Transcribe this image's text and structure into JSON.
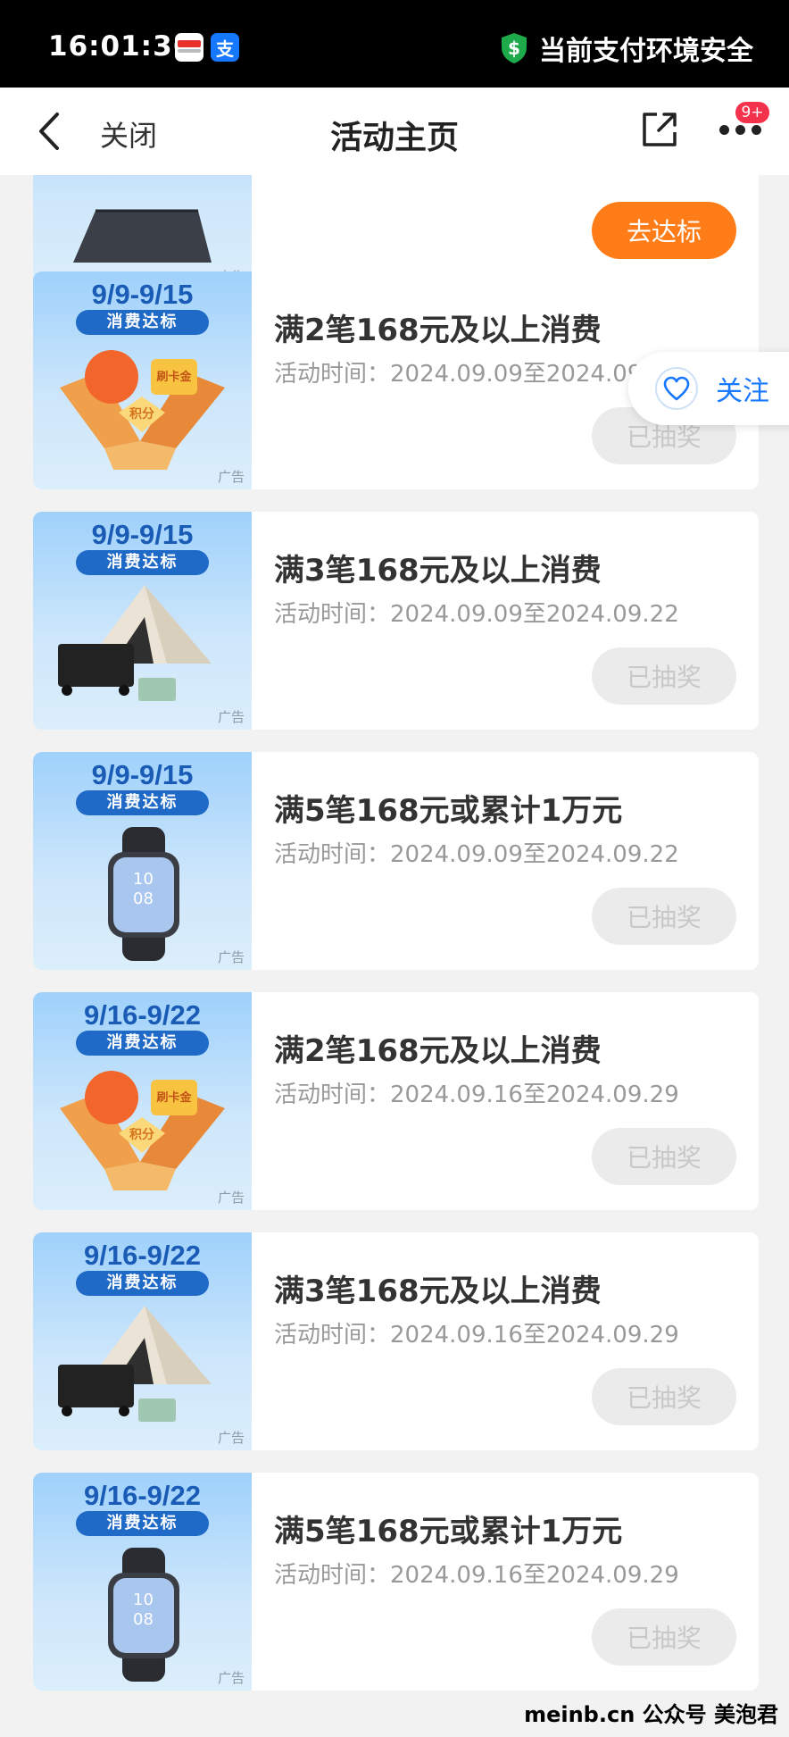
{
  "status_bar": {
    "time": "16:01:36",
    "app_icons": [
      "red-payment-app-icon",
      "alipay-icon"
    ],
    "security_text": "当前支付环境安全"
  },
  "nav": {
    "close_label": "关闭",
    "title": "活动主页",
    "badge": "9+"
  },
  "top_card": {
    "button": "去达标",
    "ad_label": "广告"
  },
  "cards": [
    {
      "date": "9/9-9/15",
      "tag": "消费达标",
      "image": "gift-box",
      "title": "满2笔168元及以上消费",
      "time": "活动时间：2024.09.09至2024.09.22",
      "button": "已抽奖",
      "ad_label": "广告"
    },
    {
      "date": "9/9-9/15",
      "tag": "消费达标",
      "image": "tent",
      "title": "满3笔168元及以上消费",
      "time": "活动时间：2024.09.09至2024.09.22",
      "button": "已抽奖",
      "ad_label": "广告"
    },
    {
      "date": "9/9-9/15",
      "tag": "消费达标",
      "image": "watch",
      "title": "满5笔168元或累计1万元",
      "time": "活动时间：2024.09.09至2024.09.22",
      "button": "已抽奖",
      "ad_label": "广告"
    },
    {
      "date": "9/16-9/22",
      "tag": "消费达标",
      "image": "gift-box",
      "title": "满2笔168元及以上消费",
      "time": "活动时间：2024.09.16至2024.09.29",
      "button": "已抽奖",
      "ad_label": "广告"
    },
    {
      "date": "9/16-9/22",
      "tag": "消费达标",
      "image": "tent",
      "title": "满3笔168元及以上消费",
      "time": "活动时间：2024.09.16至2024.09.29",
      "button": "已抽奖",
      "ad_label": "广告"
    },
    {
      "date": "9/16-9/22",
      "tag": "消费达标",
      "image": "watch",
      "title": "满5笔168元或累计1万元",
      "time": "活动时间：2024.09.16至2024.09.29",
      "button": "已抽奖",
      "ad_label": "广告"
    }
  ],
  "follow": {
    "label": "关注"
  },
  "watermark": "meinb.cn  公众号 美泡君"
}
